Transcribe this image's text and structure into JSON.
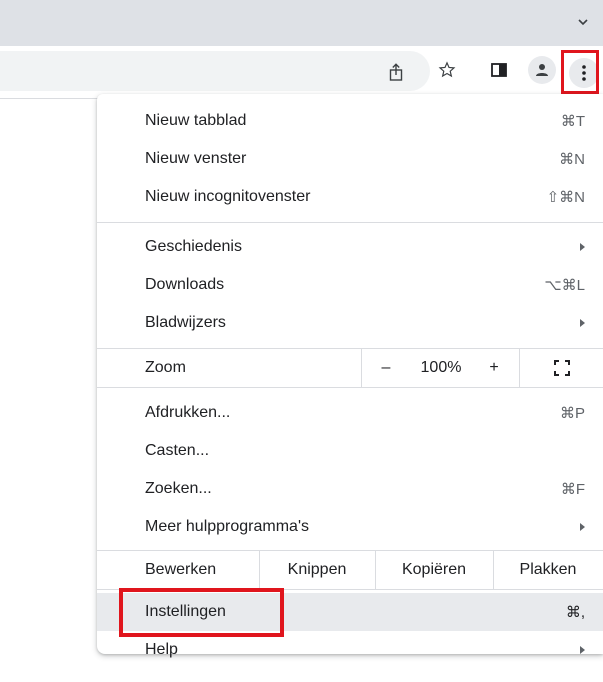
{
  "browser": {
    "toolbar_icons": [
      "share-icon",
      "bookmark-star-icon",
      "side-panel-icon",
      "profile-icon",
      "more-vert-icon"
    ]
  },
  "menu": {
    "group1": [
      {
        "label": "Nieuw tabblad",
        "shortcut": "⌘T"
      },
      {
        "label": "Nieuw venster",
        "shortcut": "⌘N"
      },
      {
        "label": "Nieuw incognitovenster",
        "shortcut": "⇧⌘N"
      }
    ],
    "group2": [
      {
        "label": "Geschiedenis",
        "submenu": true
      },
      {
        "label": "Downloads",
        "shortcut": "⌥⌘L"
      },
      {
        "label": "Bladwijzers",
        "submenu": true
      }
    ],
    "zoom": {
      "label": "Zoom",
      "minus": "–",
      "value": "100%",
      "plus": "+"
    },
    "group3": [
      {
        "label": "Afdrukken...",
        "shortcut": "⌘P"
      },
      {
        "label": "Casten..."
      },
      {
        "label": "Zoeken...",
        "shortcut": "⌘F"
      },
      {
        "label": "Meer hulpprogramma's",
        "submenu": true
      }
    ],
    "edit": {
      "label": "Bewerken",
      "cut": "Knippen",
      "copy": "Kopiëren",
      "paste": "Plakken"
    },
    "group4": [
      {
        "label": "Instellingen",
        "shortcut": "⌘,"
      },
      {
        "label": "Help",
        "submenu": true
      }
    ]
  },
  "annotation_color": "#e0151d"
}
